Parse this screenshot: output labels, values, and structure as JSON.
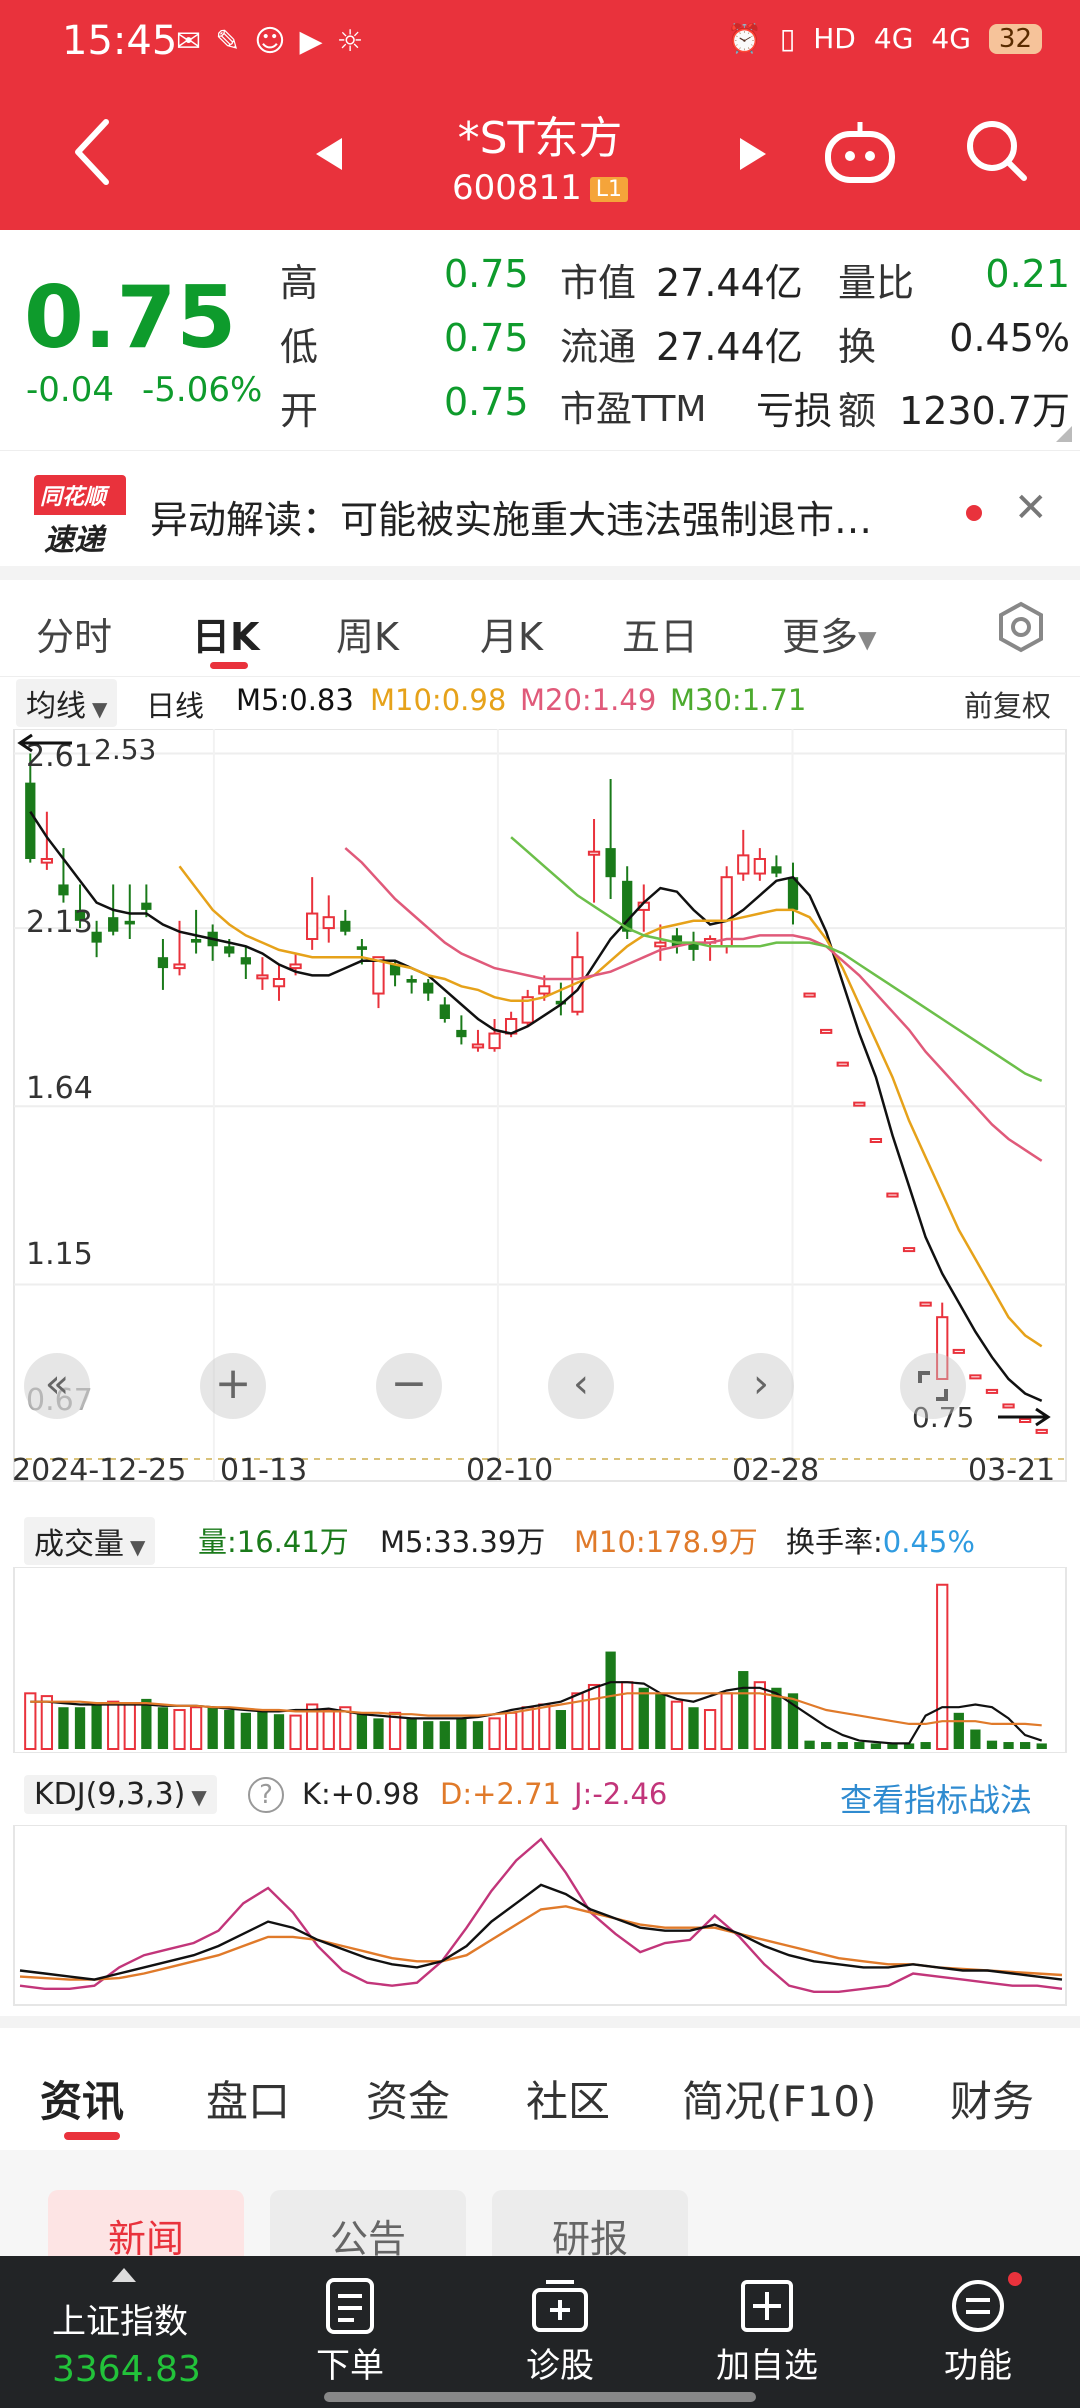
{
  "status_bar": {
    "time": "15:45",
    "battery": "32",
    "net1": "4G",
    "net2": "4G",
    "hd": "HD"
  },
  "header": {
    "title": "*ST东方",
    "code": "600811",
    "level_badge": "L1"
  },
  "quote": {
    "price": "0.75",
    "change": "-0.04",
    "change_pct": "-5.06%",
    "high_label": "高",
    "high": "0.75",
    "low_label": "低",
    "low": "0.75",
    "open_label": "开",
    "open": "0.75",
    "mktcap_label": "市值",
    "mktcap": "27.44亿",
    "float_label": "流通",
    "float": "27.44亿",
    "pe_label": "市盈TTM",
    "pe": "亏损",
    "volratio_label": "量比",
    "volratio": "0.21",
    "turnover_label": "换",
    "turnover": "0.45%",
    "amount_label": "额",
    "amount": "1230.7万"
  },
  "alert": {
    "logo_top": "同花顺",
    "logo_bottom": "速递",
    "text": "异动解读：可能被实施重大违法强制退市…"
  },
  "period_tabs": [
    "分时",
    "日K",
    "周K",
    "月K",
    "五日",
    "更多"
  ],
  "active_period": "日K",
  "ma_legend": {
    "dropdown": "均线",
    "period": "日线",
    "m5": "M5:0.83",
    "m10": "M10:0.98",
    "m20": "M20:1.49",
    "m30": "M30:1.71",
    "adjust": "前复权"
  },
  "price_axis": [
    "2.61",
    "2.13",
    "1.64",
    "1.15",
    "0.67"
  ],
  "price_annotations": {
    "max": "2.53",
    "min": "0.75"
  },
  "date_axis": [
    "2024-12-25",
    "01-13",
    "02-10",
    "02-28",
    "03-21"
  ],
  "volume_legend": {
    "dropdown": "成交量",
    "vol": "量:16.41万",
    "m5": "M5:33.39万",
    "m10": "M10:178.9万",
    "turnover_label": "换手率:",
    "turnover": "0.45%"
  },
  "kdj_legend": {
    "dropdown": "KDJ(9,3,3)",
    "help": "?",
    "k": "K:+0.98",
    "d": "D:+2.71",
    "j": "J:-2.46",
    "link": "查看指标战法"
  },
  "bottom_tabs": [
    "资讯",
    "盘口",
    "资金",
    "社区",
    "简况(F10)",
    "财务"
  ],
  "sub_tabs": [
    "新闻",
    "公告",
    "研报"
  ],
  "bottom_bar": {
    "index_name": "上证指数",
    "index_value": "3364.83",
    "items": [
      "下单",
      "诊股",
      "加自选",
      "功能"
    ]
  },
  "colors": {
    "up": "#e9323c",
    "down": "#1a7a1a",
    "ma5": "#111111",
    "ma10": "#e6a21a",
    "ma20": "#e05a7a",
    "ma30": "#6cbf4a"
  },
  "chart_data": {
    "type": "candlestick",
    "ylim": [
      0.67,
      2.65
    ],
    "y_ticks": [
      2.61,
      2.13,
      1.64,
      1.15,
      0.67
    ],
    "x_ticks": [
      "2024-12-25",
      "01-13",
      "02-10",
      "02-28",
      "03-21"
    ],
    "series": [
      {
        "name": "K",
        "ohlc": [
          [
            2.53,
            2.61,
            2.32,
            2.31
          ],
          [
            2.31,
            2.45,
            2.32,
            2.29
          ],
          [
            2.25,
            2.35,
            2.22,
            2.2
          ],
          [
            2.18,
            2.25,
            2.15,
            2.13
          ],
          [
            2.12,
            2.15,
            2.09,
            2.05
          ],
          [
            2.16,
            2.25,
            2.12,
            2.11
          ],
          [
            2.15,
            2.25,
            2.14,
            2.1
          ],
          [
            2.2,
            2.25,
            2.18,
            2.16
          ],
          [
            2.05,
            2.1,
            2.02,
            1.96
          ],
          [
            2.02,
            2.15,
            2.03,
            2.0
          ],
          [
            2.1,
            2.18,
            2.09,
            2.06
          ],
          [
            2.12,
            2.14,
            2.08,
            2.04
          ],
          [
            2.08,
            2.1,
            2.06,
            2.05
          ],
          [
            2.05,
            2.08,
            2.03,
            1.99
          ],
          [
            2.0,
            2.05,
            2.0,
            1.96
          ],
          [
            1.97,
            2.03,
            1.99,
            1.93
          ],
          [
            2.02,
            2.06,
            2.03,
            2.0
          ],
          [
            2.1,
            2.27,
            2.17,
            2.07
          ],
          [
            2.13,
            2.22,
            2.16,
            2.09
          ],
          [
            2.15,
            2.18,
            2.12,
            2.11
          ],
          [
            2.08,
            2.1,
            2.07,
            2.03
          ],
          [
            1.95,
            2.05,
            2.05,
            1.91
          ],
          [
            2.03,
            2.04,
            2.0,
            1.97
          ],
          [
            1.99,
            2.0,
            1.98,
            1.95
          ],
          [
            1.98,
            1.99,
            1.95,
            1.93
          ],
          [
            1.92,
            1.94,
            1.88,
            1.87
          ],
          [
            1.85,
            1.89,
            1.83,
            1.81
          ],
          [
            1.81,
            1.85,
            1.81,
            1.79
          ],
          [
            1.8,
            1.88,
            1.84,
            1.79
          ],
          [
            1.84,
            1.9,
            1.88,
            1.83
          ],
          [
            1.87,
            1.96,
            1.94,
            1.86
          ],
          [
            1.95,
            2.0,
            1.97,
            1.93
          ],
          [
            1.93,
            1.98,
            1.92,
            1.89
          ],
          [
            1.9,
            2.12,
            2.05,
            1.89
          ],
          [
            2.34,
            2.43,
            2.34,
            2.2
          ],
          [
            2.35,
            2.54,
            2.27,
            2.21
          ],
          [
            2.26,
            2.3,
            2.12,
            2.1
          ],
          [
            2.18,
            2.25,
            2.2,
            2.12
          ],
          [
            2.08,
            2.14,
            2.09,
            2.04
          ],
          [
            2.11,
            2.13,
            2.08,
            2.06
          ],
          [
            2.09,
            2.12,
            2.07,
            2.04
          ],
          [
            2.09,
            2.11,
            2.1,
            2.04
          ],
          [
            2.08,
            2.3,
            2.27,
            2.06
          ],
          [
            2.28,
            2.4,
            2.33,
            2.26
          ],
          [
            2.28,
            2.35,
            2.32,
            2.26
          ],
          [
            2.3,
            2.33,
            2.28,
            2.27
          ],
          [
            2.27,
            2.31,
            2.18,
            2.14
          ],
          [
            1.95,
            1.95,
            1.95,
            1.95
          ],
          [
            1.85,
            1.85,
            1.85,
            1.85
          ],
          [
            1.76,
            1.76,
            1.76,
            1.76
          ],
          [
            1.65,
            1.65,
            1.65,
            1.65
          ],
          [
            1.55,
            1.55,
            1.55,
            1.55
          ],
          [
            1.4,
            1.4,
            1.4,
            1.4
          ],
          [
            1.25,
            1.25,
            1.25,
            1.25
          ],
          [
            1.1,
            1.1,
            1.1,
            1.1
          ],
          [
            0.89,
            1.1,
            1.06,
            0.89
          ],
          [
            0.97,
            0.97,
            0.97,
            0.97
          ],
          [
            0.9,
            0.9,
            0.9,
            0.9
          ],
          [
            0.86,
            0.86,
            0.86,
            0.86
          ],
          [
            0.82,
            0.82,
            0.82,
            0.82
          ],
          [
            0.78,
            0.78,
            0.78,
            0.78
          ],
          [
            0.75,
            0.75,
            0.75,
            0.75
          ]
        ]
      },
      {
        "name": "M5",
        "values": [
          2.45,
          2.38,
          2.32,
          2.26,
          2.2,
          2.18,
          2.17,
          2.17,
          2.14,
          2.12,
          2.11,
          2.1,
          2.09,
          2.08,
          2.06,
          2.03,
          2.01,
          2.0,
          2.0,
          2.02,
          2.04,
          2.04,
          2.04,
          2.02,
          2.0,
          1.96,
          1.92,
          1.88,
          1.85,
          1.84,
          1.86,
          1.89,
          1.92,
          1.96,
          2.03,
          2.1,
          2.15,
          2.2,
          2.24,
          2.23,
          2.18,
          2.14,
          2.15,
          2.18,
          2.22,
          2.26,
          2.27,
          2.22,
          2.12,
          1.98,
          1.84,
          1.72,
          1.56,
          1.42,
          1.28,
          1.18,
          1.1,
          1.02,
          0.95,
          0.89,
          0.85,
          0.83
        ]
      },
      {
        "name": "M10",
        "values": [
          null,
          null,
          null,
          null,
          null,
          null,
          null,
          null,
          null,
          2.3,
          2.24,
          2.18,
          2.14,
          2.11,
          2.09,
          2.07,
          2.06,
          2.05,
          2.05,
          2.05,
          2.05,
          2.04,
          2.03,
          2.02,
          2.0,
          1.99,
          1.97,
          1.96,
          1.94,
          1.93,
          1.93,
          1.94,
          1.96,
          1.98,
          2.0,
          2.04,
          2.08,
          2.11,
          2.13,
          2.14,
          2.15,
          2.15,
          2.15,
          2.16,
          2.17,
          2.18,
          2.18,
          2.16,
          2.1,
          2.02,
          1.92,
          1.82,
          1.72,
          1.6,
          1.5,
          1.4,
          1.3,
          1.22,
          1.14,
          1.06,
          1.01,
          0.98
        ]
      },
      {
        "name": "M20",
        "values": [
          null,
          null,
          null,
          null,
          null,
          null,
          null,
          null,
          null,
          null,
          null,
          null,
          null,
          null,
          null,
          null,
          null,
          null,
          null,
          2.35,
          2.31,
          2.26,
          2.21,
          2.17,
          2.13,
          2.09,
          2.06,
          2.04,
          2.02,
          2.01,
          2.0,
          1.99,
          1.99,
          1.99,
          2.0,
          2.01,
          2.03,
          2.05,
          2.07,
          2.08,
          2.09,
          2.09,
          2.1,
          2.1,
          2.11,
          2.11,
          2.11,
          2.1,
          2.08,
          2.04,
          2.0,
          1.95,
          1.9,
          1.85,
          1.79,
          1.74,
          1.69,
          1.64,
          1.59,
          1.55,
          1.52,
          1.49
        ]
      },
      {
        "name": "M30",
        "values": [
          null,
          null,
          null,
          null,
          null,
          null,
          null,
          null,
          null,
          null,
          null,
          null,
          null,
          null,
          null,
          null,
          null,
          null,
          null,
          null,
          null,
          null,
          null,
          null,
          null,
          null,
          null,
          null,
          null,
          2.38,
          2.34,
          2.3,
          2.26,
          2.22,
          2.19,
          2.16,
          2.13,
          2.11,
          2.1,
          2.09,
          2.09,
          2.08,
          2.08,
          2.08,
          2.08,
          2.09,
          2.09,
          2.09,
          2.08,
          2.06,
          2.03,
          2.0,
          1.97,
          1.94,
          1.91,
          1.88,
          1.85,
          1.82,
          1.79,
          1.76,
          1.73,
          1.71
        ]
      }
    ]
  },
  "volume_data": {
    "type": "bar",
    "values": [
      40,
      38,
      30,
      30,
      32,
      34,
      32,
      36,
      30,
      28,
      30,
      30,
      28,
      26,
      28,
      25,
      24,
      32,
      28,
      30,
      26,
      22,
      26,
      22,
      20,
      20,
      22,
      20,
      22,
      26,
      30,
      32,
      28,
      40,
      46,
      70,
      48,
      44,
      40,
      34,
      30,
      28,
      40,
      56,
      48,
      44,
      40,
      6,
      5,
      5,
      5,
      4,
      4,
      4,
      5,
      118,
      26,
      14,
      6,
      5,
      5,
      4
    ],
    "up": [
      true,
      true,
      false,
      false,
      false,
      true,
      true,
      false,
      false,
      true,
      true,
      false,
      false,
      false,
      false,
      false,
      true,
      true,
      true,
      true,
      false,
      false,
      true,
      false,
      false,
      false,
      false,
      false,
      true,
      true,
      true,
      true,
      false,
      true,
      true,
      false,
      true,
      false,
      false,
      true,
      false,
      true,
      true,
      false,
      true,
      false,
      false,
      false,
      false,
      false,
      false,
      false,
      false,
      false,
      false,
      true,
      false,
      false,
      false,
      false,
      false,
      false
    ],
    "m5": [
      34,
      34,
      33,
      32,
      32,
      32,
      32,
      32,
      31,
      31,
      31,
      30,
      29,
      28,
      27,
      27,
      28,
      28,
      29,
      27,
      25,
      24,
      23,
      22,
      22,
      22,
      22,
      23,
      25,
      28,
      30,
      32,
      34,
      39,
      44,
      48,
      48,
      47,
      40,
      36,
      34,
      38,
      42,
      44,
      44,
      40,
      32,
      24,
      16,
      10,
      6,
      5,
      4,
      4,
      24,
      30,
      30,
      32,
      30,
      22,
      10,
      6
    ],
    "m10": [
      34,
      34,
      34,
      34,
      33,
      33,
      33,
      33,
      32,
      31,
      31,
      30,
      30,
      29,
      28,
      28,
      27,
      27,
      27,
      27,
      26,
      26,
      25,
      25,
      24,
      24,
      24,
      24,
      25,
      26,
      28,
      30,
      32,
      34,
      36,
      38,
      40,
      40,
      40,
      40,
      40,
      40,
      40,
      40,
      40,
      38,
      36,
      32,
      28,
      26,
      24,
      22,
      20,
      18,
      18,
      20,
      20,
      20,
      18,
      18,
      18,
      17
    ]
  },
  "kdj_data": {
    "type": "line",
    "K": [
      20,
      18,
      16,
      14,
      18,
      22,
      26,
      30,
      36,
      44,
      52,
      48,
      40,
      34,
      28,
      24,
      22,
      26,
      36,
      52,
      64,
      76,
      70,
      60,
      54,
      48,
      46,
      46,
      50,
      44,
      36,
      30,
      26,
      24,
      22,
      22,
      24,
      22,
      20,
      20,
      18,
      16,
      14
    ],
    "D": [
      16,
      15,
      14,
      14,
      15,
      18,
      22,
      26,
      30,
      36,
      42,
      42,
      40,
      36,
      32,
      28,
      26,
      26,
      30,
      40,
      50,
      60,
      62,
      58,
      54,
      50,
      48,
      48,
      48,
      44,
      40,
      36,
      32,
      28,
      26,
      24,
      24,
      22,
      21,
      20,
      19,
      18,
      17
    ],
    "J": [
      10,
      8,
      8,
      10,
      22,
      30,
      34,
      38,
      46,
      64,
      74,
      58,
      36,
      20,
      12,
      10,
      12,
      26,
      48,
      72,
      92,
      106,
      84,
      58,
      44,
      32,
      38,
      40,
      56,
      42,
      24,
      10,
      6,
      6,
      8,
      10,
      18,
      16,
      14,
      12,
      10,
      10,
      8
    ]
  }
}
